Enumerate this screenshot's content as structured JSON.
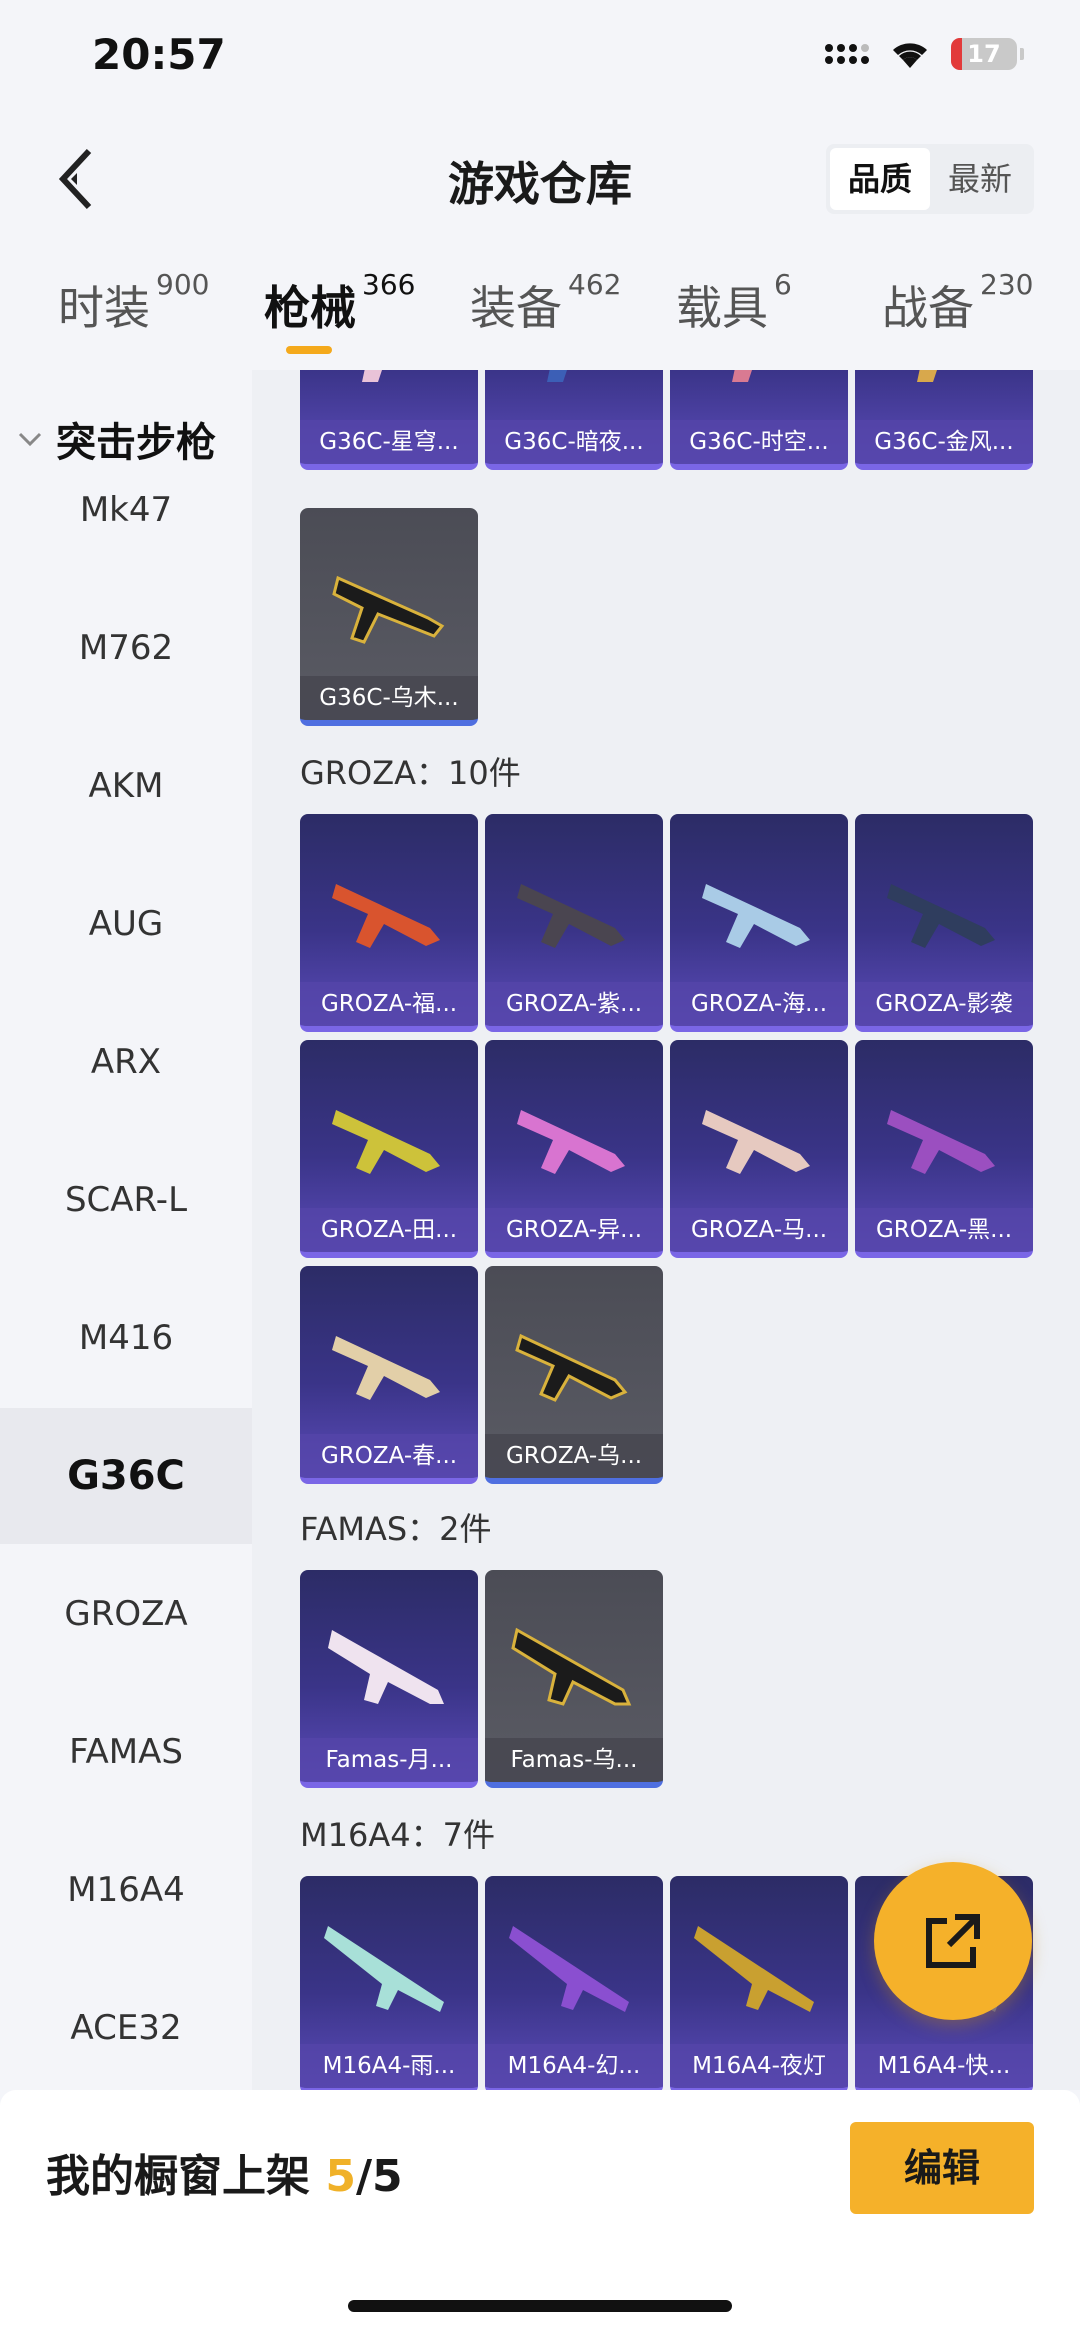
{
  "status": {
    "time": "20:57",
    "battery": "17",
    "battery_level": 0.17,
    "signal_icon": "cellular-signal-icon",
    "wifi_icon": "wifi-icon"
  },
  "header": {
    "title": "游戏仓库",
    "sort_options": [
      "品质",
      "最新"
    ],
    "sort_active": "品质"
  },
  "tabs": [
    {
      "label": "时装",
      "count": "900"
    },
    {
      "label": "枪械",
      "count": "366",
      "active": true
    },
    {
      "label": "装备",
      "count": "462"
    },
    {
      "label": "载具",
      "count": "6"
    },
    {
      "label": "战备",
      "count": "230"
    }
  ],
  "sidebar": {
    "group": "突击步枪",
    "items": [
      "Mk47",
      "M762",
      "AKM",
      "AUG",
      "ARX",
      "SCAR-L",
      "M416",
      "G36C",
      "GROZA",
      "FAMAS",
      "M16A4",
      "ACE32"
    ],
    "active": "G36C"
  },
  "sections": {
    "g36c_top": [
      "G36C-星穹...",
      "G36C-暗夜...",
      "G36C-时空...",
      "G36C-金风...",
      "G36C-乌木..."
    ],
    "groza": {
      "title": "GROZA：10件",
      "items": [
        "GROZA-福...",
        "GROZA-紫...",
        "GROZA-海...",
        "GROZA-影袭",
        "GROZA-田...",
        "GROZA-异...",
        "GROZA-马...",
        "GROZA-黑...",
        "GROZA-春...",
        "GROZA-乌..."
      ]
    },
    "famas": {
      "title": "FAMAS：2件",
      "items": [
        "Famas-月...",
        "Famas-乌..."
      ]
    },
    "m16a4": {
      "title": "M16A4：7件",
      "items": [
        "M16A4-雨...",
        "M16A4-幻...",
        "M16A4-夜灯",
        "M16A4-快..."
      ]
    }
  },
  "bottom": {
    "label": "我的橱窗上架",
    "count": "5",
    "total": "/5",
    "edit": "编辑"
  },
  "colors": {
    "accent": "#f5b12a",
    "card_purple": "#3a3488",
    "card_grey": "#55565f"
  }
}
